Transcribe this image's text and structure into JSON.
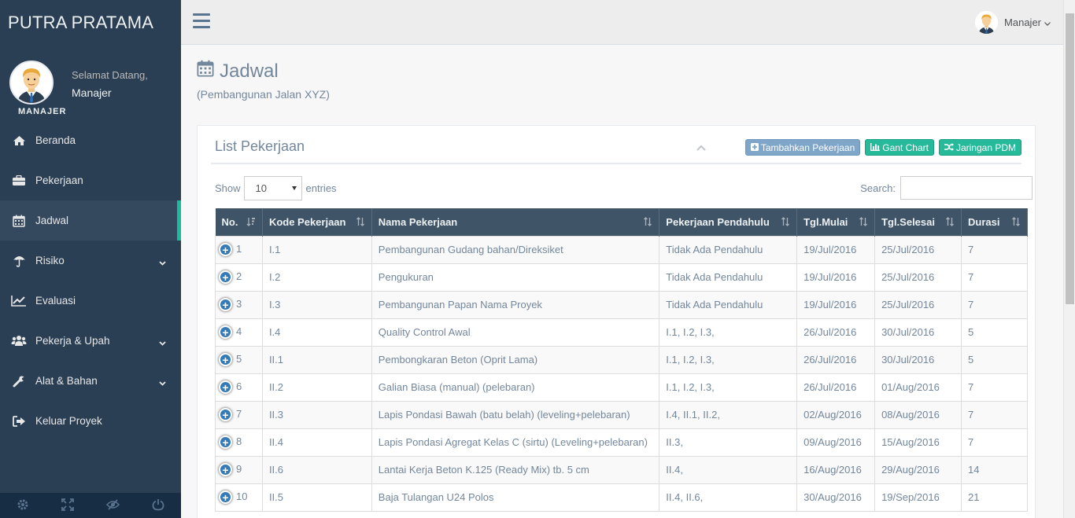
{
  "brand": "PUTRA PRATAMA",
  "profile": {
    "welcome": "Selamat Datang,",
    "name": "Manajer",
    "role": "MANAJER"
  },
  "menu": [
    {
      "label": "Beranda",
      "icon": "home-icon",
      "active": false,
      "has_submenu": false
    },
    {
      "label": "Pekerjaan",
      "icon": "briefcase-icon",
      "active": false,
      "has_submenu": false
    },
    {
      "label": "Jadwal",
      "icon": "calendar-icon",
      "active": true,
      "has_submenu": false
    },
    {
      "label": "Risiko",
      "icon": "umbrella-icon",
      "active": false,
      "has_submenu": true
    },
    {
      "label": "Evaluasi",
      "icon": "line-chart-icon",
      "active": false,
      "has_submenu": false
    },
    {
      "label": "Pekerja & Upah",
      "icon": "users-icon",
      "active": false,
      "has_submenu": true
    },
    {
      "label": "Alat & Bahan",
      "icon": "wrench-icon",
      "active": false,
      "has_submenu": true
    },
    {
      "label": "Keluar Proyek",
      "icon": "sign-out-icon",
      "active": false,
      "has_submenu": false
    }
  ],
  "topnav": {
    "user_label": "Manajer"
  },
  "page": {
    "title": "Jadwal",
    "subtitle": "(Pembangunan Jalan XYZ)"
  },
  "panel": {
    "title": "List Pekerjaan",
    "buttons": {
      "add": "Tambahkan Pekerjaan",
      "gant": "Gant Chart",
      "pdm": "Jaringan PDM"
    },
    "show_label": "Show",
    "entries_value": "10",
    "entries_label": "entries",
    "search_label": "Search:"
  },
  "table": {
    "headers": [
      "No.",
      "Kode Pekerjaan",
      "Nama Pekerjaan",
      "Pekerjaan Pendahulu",
      "Tgl.Mulai",
      "Tgl.Selesai",
      "Durasi"
    ],
    "rows": [
      [
        "1",
        "I.1",
        "Pembangunan Gudang bahan/Direksiket",
        "Tidak Ada Pendahulu",
        "19/Jul/2016",
        "25/Jul/2016",
        "7"
      ],
      [
        "2",
        "I.2",
        "Pengukuran",
        "Tidak Ada Pendahulu",
        "19/Jul/2016",
        "25/Jul/2016",
        "7"
      ],
      [
        "3",
        "I.3",
        "Pembangunan Papan Nama Proyek",
        "Tidak Ada Pendahulu",
        "19/Jul/2016",
        "25/Jul/2016",
        "7"
      ],
      [
        "4",
        "I.4",
        "Quality Control Awal",
        "I.1, I.2, I.3,",
        "26/Jul/2016",
        "30/Jul/2016",
        "5"
      ],
      [
        "5",
        "II.1",
        "Pembongkaran Beton (Oprit Lama)",
        "I.1, I.2, I.3,",
        "26/Jul/2016",
        "30/Jul/2016",
        "5"
      ],
      [
        "6",
        "II.2",
        "Galian Biasa (manual) (pelebaran)",
        "I.1, I.2, I.3,",
        "26/Jul/2016",
        "01/Aug/2016",
        "7"
      ],
      [
        "7",
        "II.3",
        "Lapis Pondasi Bawah (batu belah) (leveling+pelebaran)",
        "I.4, II.1, II.2,",
        "02/Aug/2016",
        "08/Aug/2016",
        "7"
      ],
      [
        "8",
        "II.4",
        "Lapis Pondasi Agregat Kelas C (sirtu) (Leveling+pelebaran)",
        "II.3,",
        "09/Aug/2016",
        "15/Aug/2016",
        "7"
      ],
      [
        "9",
        "II.6",
        "Lantai Kerja Beton K.125 (Ready Mix) tb. 5 cm",
        "II.4,",
        "16/Aug/2016",
        "29/Aug/2016",
        "14"
      ],
      [
        "10",
        "II.5",
        "Baja Tulangan U24 Polos",
        "II.4, II.6,",
        "30/Aug/2016",
        "19/Sep/2016",
        "21"
      ]
    ]
  },
  "colors": {
    "sidebar": "#2a3f54",
    "accent": "#1abb9c",
    "header": "#405467",
    "primary_btn": "#7fa5c8",
    "success_btn": "#26b99a"
  }
}
